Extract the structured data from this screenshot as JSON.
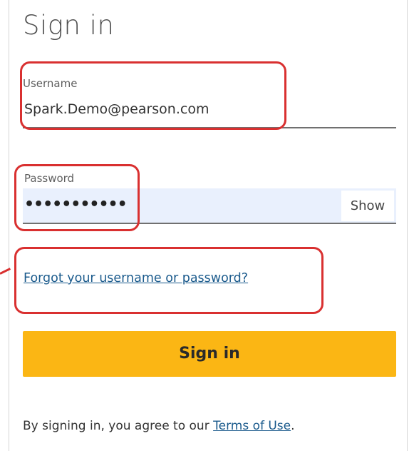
{
  "title": "Sign in",
  "username": {
    "label": "Username",
    "value": "Spark.Demo@pearson.com"
  },
  "password": {
    "label": "Password",
    "masked_value": "•••••••••••",
    "show_label": "Show"
  },
  "forgot_link": "Forgot your username or password?",
  "signin_button": "Sign in",
  "agreement": {
    "prefix": "By signing in, you agree to our ",
    "terms_link": "Terms of Use",
    "suffix": "."
  },
  "colors": {
    "accent_button": "#fbb614",
    "link": "#1a5a8c",
    "highlight_annotation": "#d93030",
    "password_field_bg": "#e9f0fd"
  }
}
